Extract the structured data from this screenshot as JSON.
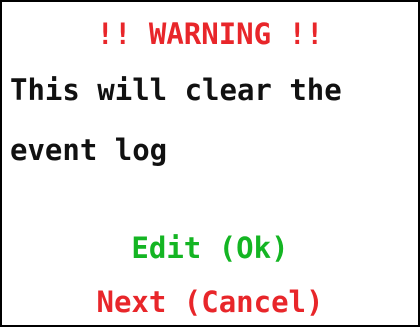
{
  "dialog": {
    "title": "!! WARNING !!",
    "message_line1": "This will clear the",
    "message_line2": "event log",
    "ok_label": "Edit (Ok)",
    "cancel_label": "Next (Cancel)"
  },
  "colors": {
    "warning": "#e8262a",
    "ok": "#14b523",
    "cancel": "#e8262a",
    "text": "#111111",
    "border": "#000000",
    "background": "#ffffff"
  }
}
